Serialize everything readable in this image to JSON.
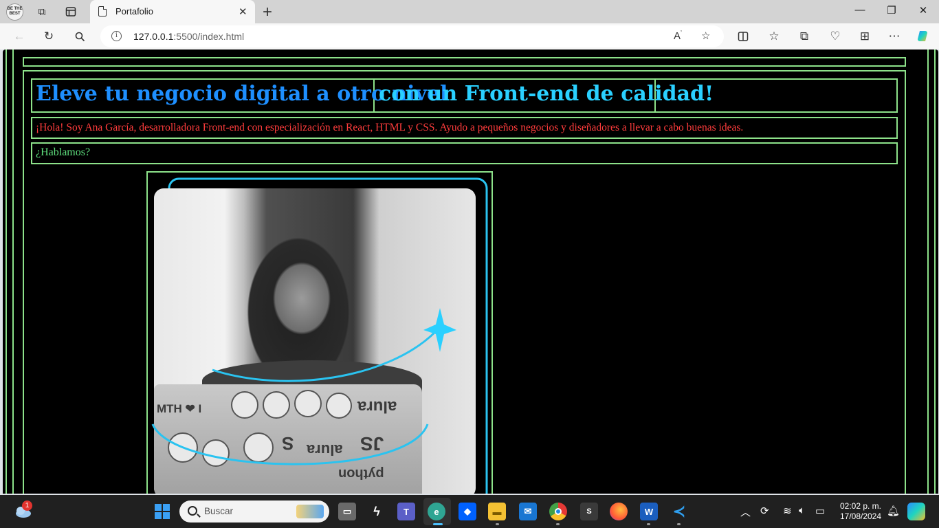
{
  "browser": {
    "tab_title": "Portafolio",
    "url_host": "127.0.0.1",
    "url_rest": ":5500/index.html",
    "profile_badge": "BE THE BEST"
  },
  "page": {
    "heading_part1": "Eleve tu negocio digital a otro nivel",
    "heading_part2": "con un Front-end de calidad!",
    "intro": "¡Hola! Soy Ana García, desarrolladora Front-end con especialización en React, HTML y CSS. Ayudo a pequeños negocios y diseñadores a llevar a cabo buenas ideas.",
    "cta": "¿Hablamos?",
    "photo_stickers": [
      "MTH ❤ I",
      "alura",
      "JS",
      "S",
      "alura",
      "python"
    ],
    "colors": {
      "border": "#8de28a",
      "heading_blue": "#1e8fff",
      "heading_cyan": "#2ad0ff",
      "intro": "#ff3c3c",
      "cta": "#5fe07e",
      "accent_arc": "#2ac3f0"
    }
  },
  "taskbar": {
    "search_placeholder": "Buscar",
    "time": "02:02 p. m.",
    "date": "17/08/2024",
    "weather_badge": "1"
  }
}
